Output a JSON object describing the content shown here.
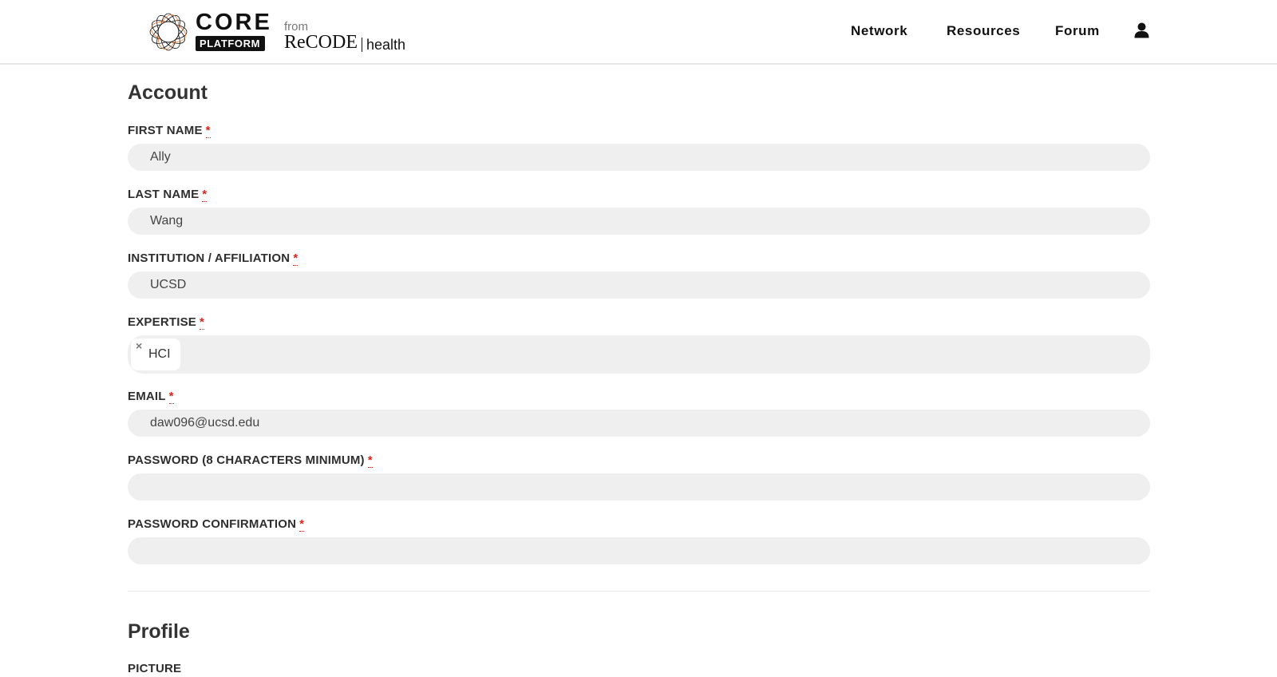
{
  "brand": {
    "core": "CORE",
    "platform": "PLATFORM",
    "from": "from",
    "recode": "ReCODE",
    "health": "health"
  },
  "nav": {
    "items": [
      "Network",
      "Resources",
      "Forum"
    ],
    "user_icon": "user-icon"
  },
  "account": {
    "title": "Account",
    "required_mark": "*",
    "first_name": {
      "label": "FIRST NAME",
      "value": "Ally"
    },
    "last_name": {
      "label": "LAST NAME",
      "value": "Wang"
    },
    "institution": {
      "label": "INSTITUTION / AFFILIATION",
      "value": "UCSD"
    },
    "expertise": {
      "label": "EXPERTISE",
      "tags": [
        "HCI"
      ],
      "remove_glyph": "×"
    },
    "email": {
      "label": "EMAIL",
      "value": "daw096@ucsd.edu"
    },
    "password": {
      "label": "PASSWORD (8 CHARACTERS MINIMUM)",
      "value": ""
    },
    "password_confirmation": {
      "label": "PASSWORD CONFIRMATION",
      "value": ""
    }
  },
  "profile": {
    "title": "Profile",
    "picture_label": "PICTURE"
  },
  "colors": {
    "required": "#d9261c",
    "input_bg": "#efefef",
    "text": "#2b2b2b"
  }
}
